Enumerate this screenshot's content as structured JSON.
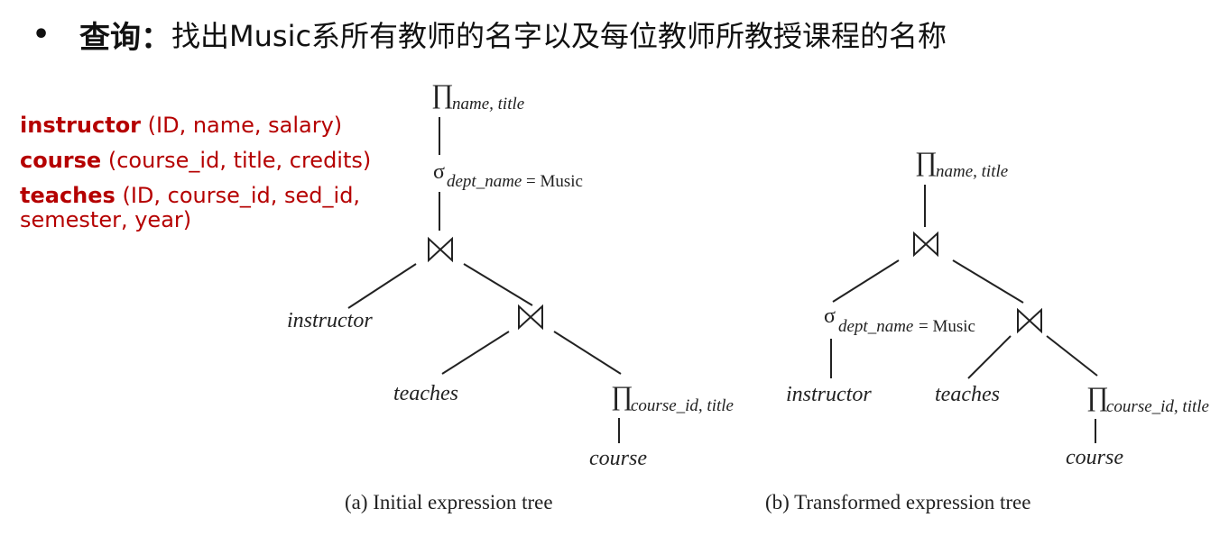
{
  "heading": {
    "bullet": "•",
    "bold": "查询：",
    "rest": "找出Music系所有教师的名字以及每位教师所教授课程的名称"
  },
  "schema": [
    {
      "table": "instructor",
      "attrs": " (ID, name, salary)"
    },
    {
      "table": "course",
      "attrs": " (course_id, title, credits)"
    },
    {
      "table": "teaches",
      "attrs": " (ID, course_id, sed_id,",
      "continuation": "semester, year)"
    }
  ],
  "symbols": {
    "project": "∏",
    "select": "σ"
  },
  "tree_a": {
    "caption": "(a) Initial expression tree",
    "root_project_sub": "name, title",
    "select_sub": "dept_name",
    "select_rest": " = Music",
    "leaf_instructor": "instructor",
    "leaf_teaches": "teaches",
    "inner_project_sub": "course_id, title",
    "leaf_course": "course"
  },
  "tree_b": {
    "caption": "(b) Transformed expression tree",
    "root_project_sub": "name, title",
    "select_sub": "dept_name",
    "select_rest": " = Music",
    "leaf_instructor": "instructor",
    "leaf_teaches": "teaches",
    "inner_project_sub": "course_id, title",
    "leaf_course": "course"
  }
}
